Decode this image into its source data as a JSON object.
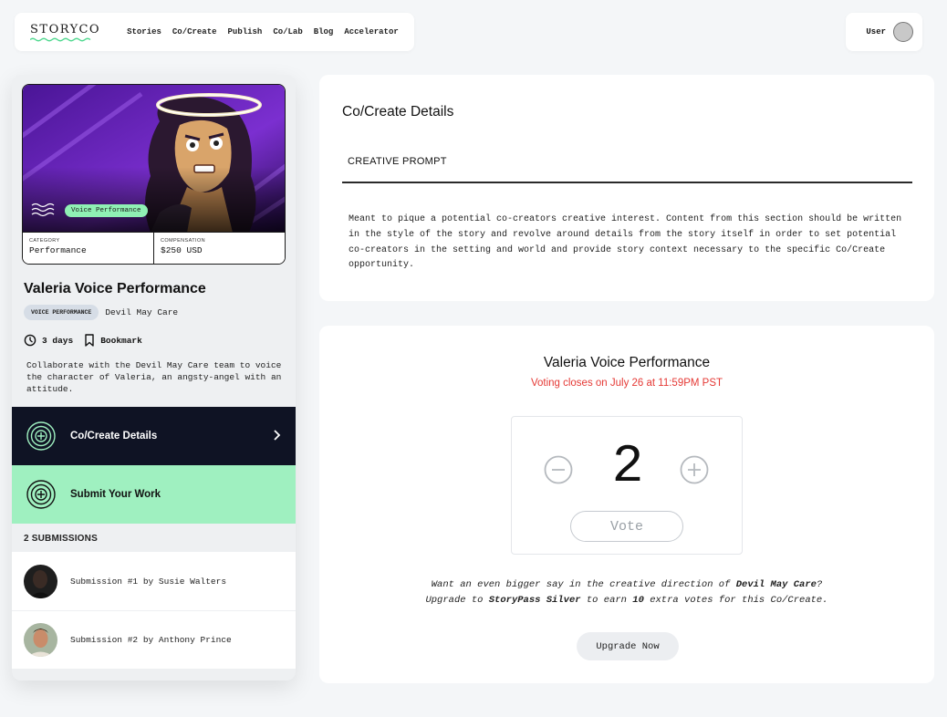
{
  "brand": {
    "logo_text": "STORYCO"
  },
  "nav": {
    "links": [
      "Stories",
      "Co/Create",
      "Publish",
      "Co/Lab",
      "Blog",
      "Accelerator"
    ],
    "user_label": "User"
  },
  "card": {
    "badge": "Voice Performance",
    "category_label": "CATEGORY",
    "category_value": "Performance",
    "compensation_label": "COMPENSATION",
    "compensation_value": "$250 USD",
    "title": "Valeria Voice Performance",
    "tag": "VOICE PERFORMANCE",
    "story_name": "Devil May Care",
    "duration": "3 days",
    "bookmark_label": "Bookmark",
    "description": "Collaborate with the Devil May Care team to voice the character of Valeria, an angsty-angel with an attitude."
  },
  "menu": {
    "details_label": "Co/Create Details",
    "submit_label": "Submit Your Work"
  },
  "submissions": {
    "header": "2 SUBMISSIONS",
    "items": [
      {
        "label": "Submission #1 by Susie Walters"
      },
      {
        "label": "Submission #2 by Anthony Prince"
      }
    ]
  },
  "details": {
    "title": "Co/Create Details",
    "tab": "CREATIVE PROMPT",
    "prompt": "Meant to pique a potential co-creators creative interest. Content from this section should be written in the style of the story and revolve around details from the story itself in order to set potential co-creators in the setting and world and provide story context necessary to the specific Co/Create opportunity."
  },
  "vote": {
    "title": "Valeria Voice Performance",
    "closes": "Voting closes on July 26 at 11:59PM PST",
    "count": "2",
    "button": "Vote",
    "upsell_line1_a": "Want an even bigger say in the creative direction of ",
    "upsell_line1_b": "Devil May Care",
    "upsell_line1_c": "?",
    "upsell_line2_a": "Upgrade to ",
    "upsell_line2_b": "StoryPass Silver",
    "upsell_line2_c": " to earn ",
    "upsell_line2_d": "10",
    "upsell_line2_e": " extra votes for this Co/Create.",
    "upgrade_button": "Upgrade Now"
  },
  "colors": {
    "accent_green": "#9ff0c0",
    "dark_navy": "#0f1324",
    "alert_red": "#e53935",
    "hero_purple": "#6a1fb5"
  }
}
